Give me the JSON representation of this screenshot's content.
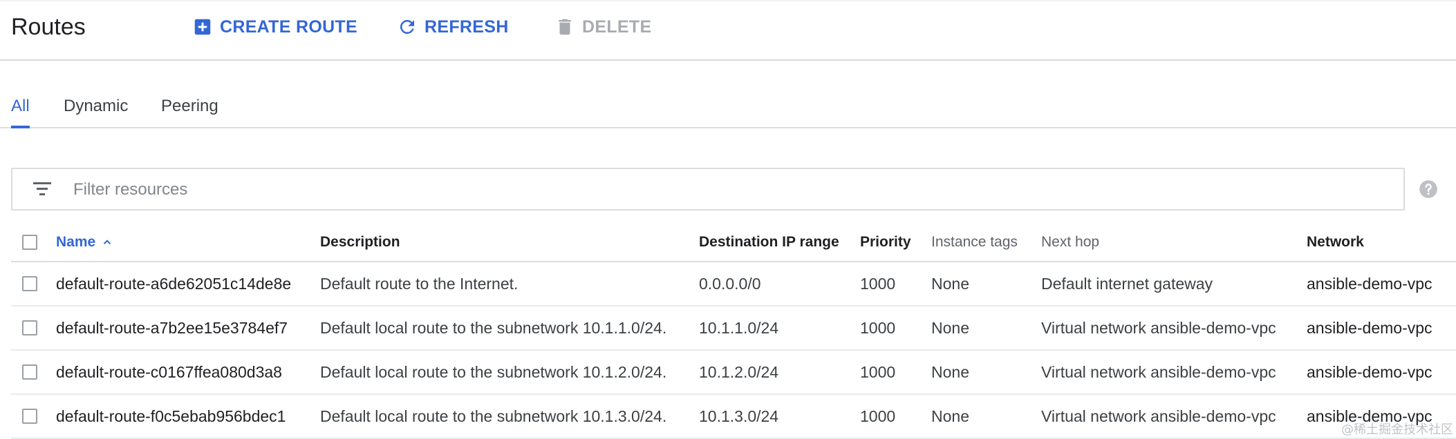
{
  "header": {
    "title": "Routes",
    "actions": {
      "create": {
        "label": "CREATE ROUTE",
        "icon": "add-box-icon"
      },
      "refresh": {
        "label": "REFRESH",
        "icon": "refresh-icon"
      },
      "delete": {
        "label": "DELETE",
        "icon": "trash-icon",
        "disabled": true
      }
    }
  },
  "tabs": [
    {
      "label": "All",
      "active": true
    },
    {
      "label": "Dynamic",
      "active": false
    },
    {
      "label": "Peering",
      "active": false
    }
  ],
  "filter": {
    "placeholder": "Filter resources",
    "value": ""
  },
  "table": {
    "columns": {
      "name": "Name",
      "description": "Description",
      "destination": "Destination IP range",
      "priority": "Priority",
      "instance_tags": "Instance tags",
      "next_hop": "Next hop",
      "network": "Network"
    },
    "sort": {
      "column": "Name",
      "direction": "ascending"
    },
    "rows": [
      {
        "name": "default-route-a6de62051c14de8e",
        "description": "Default route to the Internet.",
        "destination": "0.0.0.0/0",
        "priority": "1000",
        "instance_tags": "None",
        "next_hop": "Default internet gateway",
        "network": "ansible-demo-vpc"
      },
      {
        "name": "default-route-a7b2ee15e3784ef7",
        "description": "Default local route to the subnetwork 10.1.1.0/24.",
        "destination": "10.1.1.0/24",
        "priority": "1000",
        "instance_tags": "None",
        "next_hop": "Virtual network ansible-demo-vpc",
        "network": "ansible-demo-vpc"
      },
      {
        "name": "default-route-c0167ffea080d3a8",
        "description": "Default local route to the subnetwork 10.1.2.0/24.",
        "destination": "10.1.2.0/24",
        "priority": "1000",
        "instance_tags": "None",
        "next_hop": "Virtual network ansible-demo-vpc",
        "network": "ansible-demo-vpc"
      },
      {
        "name": "default-route-f0c5ebab956bdec1",
        "description": "Default local route to the subnetwork 10.1.3.0/24.",
        "destination": "10.1.3.0/24",
        "priority": "1000",
        "instance_tags": "None",
        "next_hop": "Virtual network ansible-demo-vpc",
        "network": "ansible-demo-vpc"
      }
    ]
  },
  "watermark": "@稀土掘金技术社区",
  "colors": {
    "accent": "#3367d6",
    "disabled": "#a8abaf",
    "border": "#dadce0"
  }
}
